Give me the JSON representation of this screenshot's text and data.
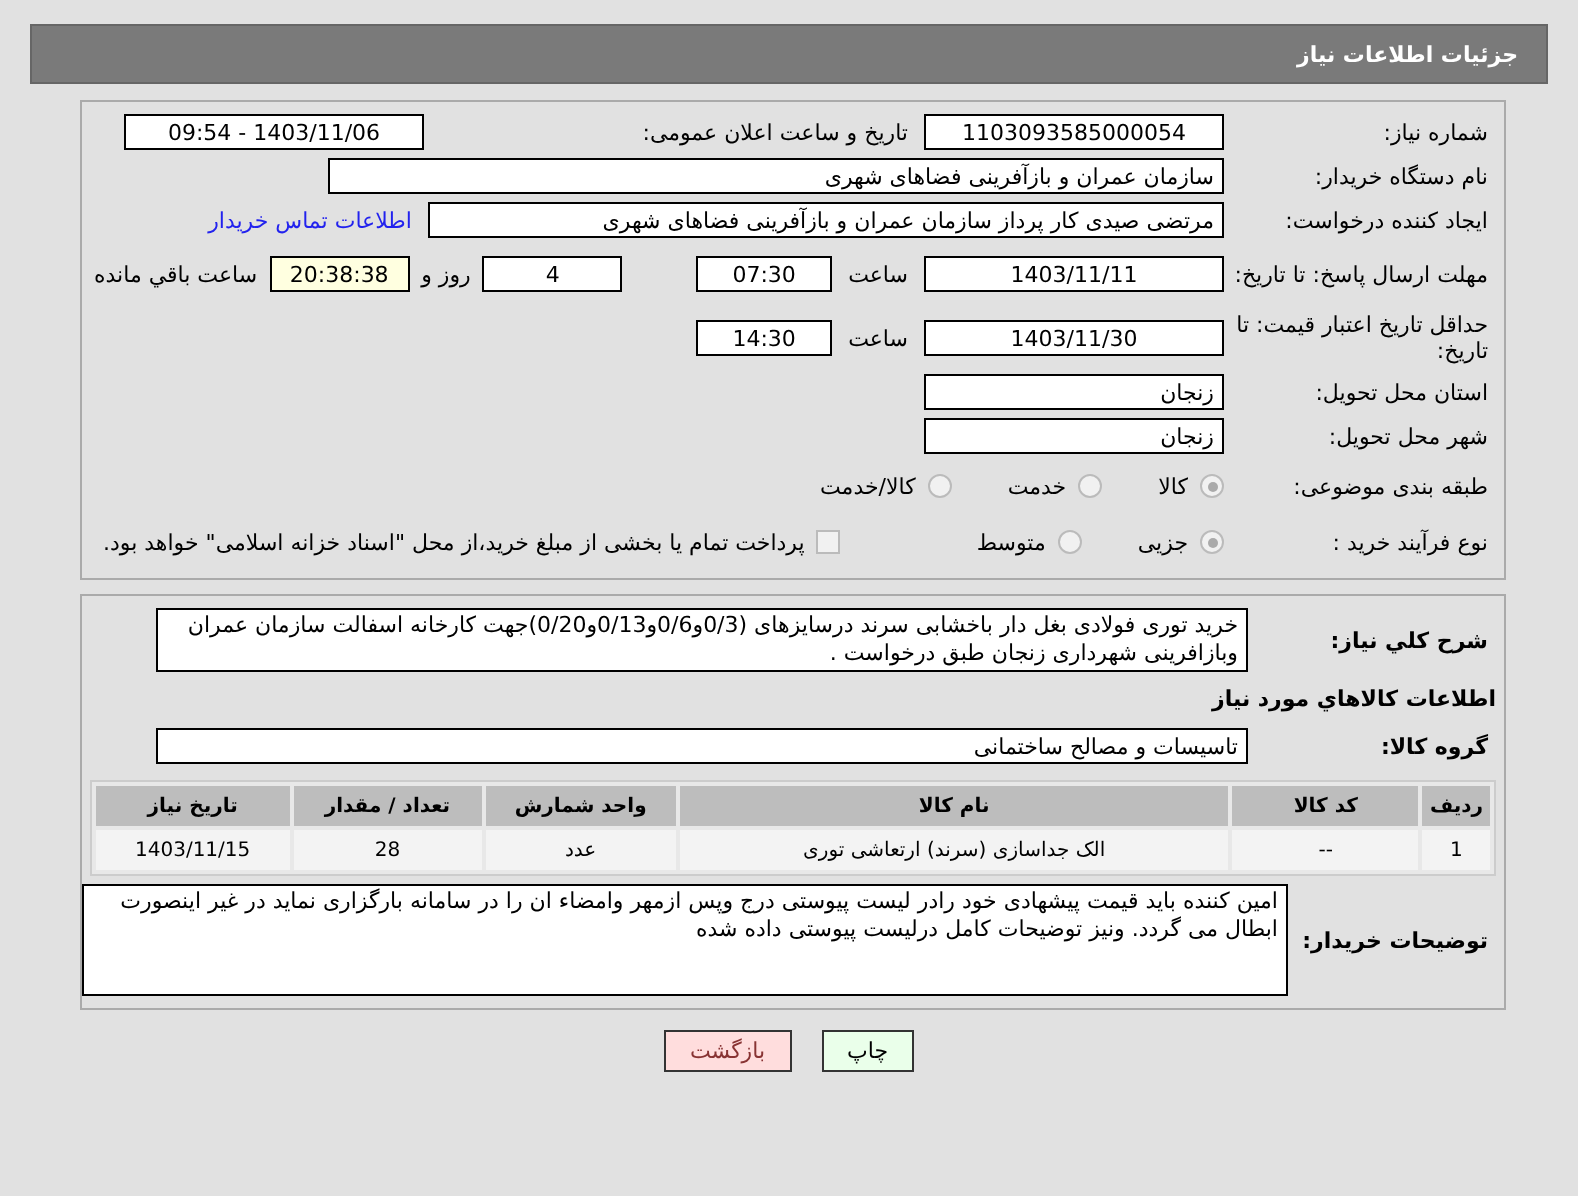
{
  "header": {
    "title": "جزئیات اطلاعات نیاز"
  },
  "details": {
    "need_number": {
      "label": "شماره نیاز:",
      "value": "1103093585000054"
    },
    "announce": {
      "label": "تاریخ و ساعت اعلان عمومی:",
      "value": "1403/11/06 - 09:54"
    },
    "buyer_org": {
      "label": "نام دستگاه خریدار:",
      "value": "سازمان عمران و بازآفرینی فضاهای شهری"
    },
    "requester": {
      "label": "ایجاد کننده درخواست:",
      "value": "مرتضی  صیدی  کار پرداز سازمان عمران و بازآفرینی فضاهای شهری",
      "link": "اطلاعات تماس خریدار"
    },
    "deadline": {
      "label": "مهلت ارسال پاسخ: تا تاریخ:",
      "date": "1403/11/11",
      "time_label": "ساعت",
      "time": "07:30",
      "days": "4",
      "days_label": "روز و",
      "remaining": "20:38:38",
      "remaining_label": "ساعت باقي مانده"
    },
    "validity": {
      "label": "حداقل تاریخ اعتبار قیمت: تا تاریخ:",
      "date": "1403/11/30",
      "time_label": "ساعت",
      "time": "14:30"
    },
    "province": {
      "label": "استان محل تحویل:",
      "value": "زنجان"
    },
    "city": {
      "label": "شهر محل تحویل:",
      "value": "زنجان"
    },
    "category": {
      "label": "طبقه بندی موضوعی:",
      "options": [
        {
          "label": "کالا",
          "selected": true
        },
        {
          "label": "خدمت",
          "selected": false
        },
        {
          "label": "کالا/خدمت",
          "selected": false
        }
      ]
    },
    "process": {
      "label": "نوع فرآیند خرید :",
      "options": [
        {
          "label": "جزیی",
          "selected": true
        },
        {
          "label": "متوسط",
          "selected": false
        }
      ],
      "treasury": {
        "label": "پرداخت تمام یا بخشی از مبلغ خرید،از محل \"اسناد خزانه اسلامی\" خواهد بود.",
        "checked": false
      }
    }
  },
  "goods": {
    "summary": {
      "label": "شرح کلي نياز:",
      "value": "خرید توری  فولادی  بغل دار باخشابی سرند درسایزهای (0/3و0/6و0/13و0/20)جهت کارخانه اسفالت سازمان عمران وبازافرینی شهرداری زنجان طبق درخواست ."
    },
    "heading": "اطلاعات كالاهاي مورد نياز",
    "group": {
      "label": "گروه کالا:",
      "value": "تاسیسات و مصالح ساختمانی"
    },
    "table": {
      "columns": [
        "ردیف",
        "کد کالا",
        "نام کالا",
        "واحد شمارش",
        "تعداد / مقدار",
        "تاریخ نیاز"
      ],
      "rows": [
        [
          "1",
          "--",
          "الک جداسازی (سرند) ارتعاشی توری",
          "عدد",
          "28",
          "1403/11/15"
        ]
      ]
    },
    "buyer_notes": {
      "label": "توضیحات خریدار:",
      "value": "امین کننده باید قیمت پیشهادی خود رادر لیست پیوستی درج وپس ازمهر وامضاء ان را در سامانه بارگزاری نماید در غیر اینصورت ابطال می گردد.  ونیز توضیحات کامل درلیست پیوستی داده شده"
    }
  },
  "buttons": [
    {
      "label": "چاپ",
      "kind": "print"
    },
    {
      "label": "بازگشت",
      "kind": "back"
    }
  ]
}
